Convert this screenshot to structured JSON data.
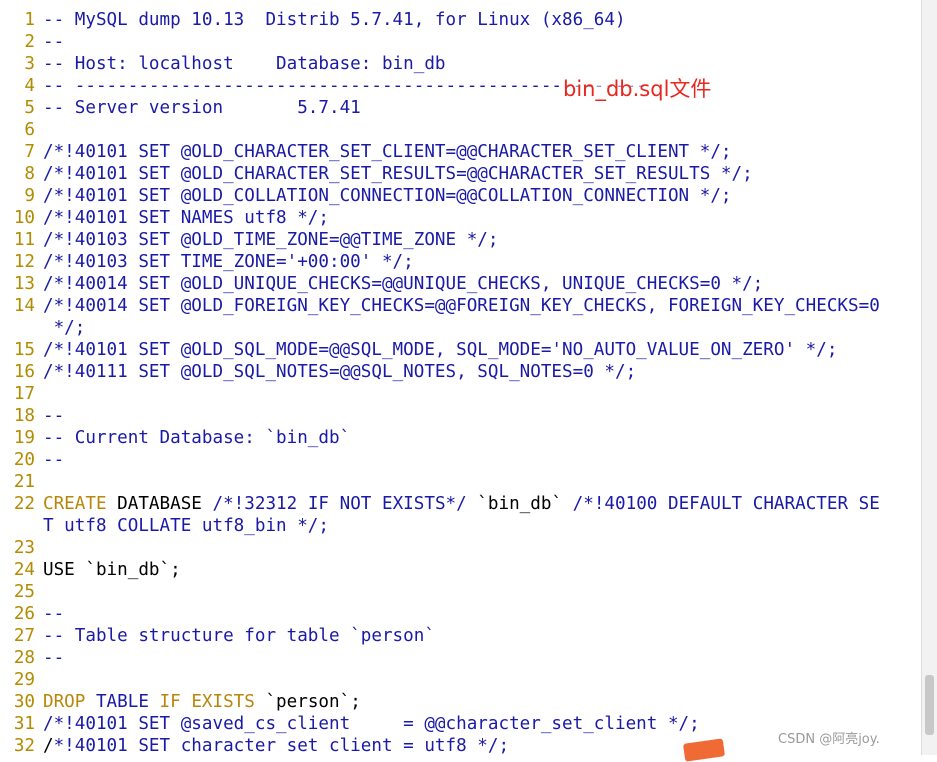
{
  "editor": {
    "lines": [
      {
        "n": "1",
        "segs": [
          {
            "t": "-- MySQL dump 10.13  Distrib 5.7.41, for Linux (x86_64)",
            "c": "comment"
          }
        ]
      },
      {
        "n": "2",
        "segs": [
          {
            "t": "--",
            "c": "comment"
          }
        ]
      },
      {
        "n": "3",
        "segs": [
          {
            "t": "-- Host: localhost    Database: bin_db",
            "c": "comment"
          }
        ]
      },
      {
        "n": "4",
        "segs": [
          {
            "t": "-- ------------------------------------------------------",
            "c": "comment"
          }
        ]
      },
      {
        "n": "5",
        "segs": [
          {
            "t": "-- Server version       5.7.41",
            "c": "comment"
          }
        ]
      },
      {
        "n": "6",
        "segs": []
      },
      {
        "n": "7",
        "segs": [
          {
            "t": "/*!40101 SET @OLD_CHARACTER_SET_CLIENT=@@CHARACTER_SET_CLIENT */;",
            "c": "comment"
          }
        ]
      },
      {
        "n": "8",
        "segs": [
          {
            "t": "/*!40101 SET @OLD_CHARACTER_SET_RESULTS=@@CHARACTER_SET_RESULTS */;",
            "c": "comment"
          }
        ]
      },
      {
        "n": "9",
        "segs": [
          {
            "t": "/*!40101 SET @OLD_COLLATION_CONNECTION=@@COLLATION_CONNECTION */;",
            "c": "comment"
          }
        ]
      },
      {
        "n": "10",
        "segs": [
          {
            "t": "/*!40101 SET NAMES utf8 */;",
            "c": "comment"
          }
        ]
      },
      {
        "n": "11",
        "segs": [
          {
            "t": "/*!40103 SET @OLD_TIME_ZONE=@@TIME_ZONE */;",
            "c": "comment"
          }
        ]
      },
      {
        "n": "12",
        "segs": [
          {
            "t": "/*!40103 SET TIME_ZONE='+00:00' */;",
            "c": "comment"
          }
        ]
      },
      {
        "n": "13",
        "segs": [
          {
            "t": "/*!40014 SET @OLD_UNIQUE_CHECKS=@@UNIQUE_CHECKS, UNIQUE_CHECKS=0 */;",
            "c": "comment"
          }
        ]
      },
      {
        "n": "14",
        "segs": [
          {
            "t": "/*!40014 SET @OLD_FOREIGN_KEY_CHECKS=@@FOREIGN_KEY_CHECKS, FOREIGN_KEY_CHECKS=0",
            "c": "comment"
          }
        ]
      },
      {
        "n": "",
        "segs": [
          {
            "t": " */;",
            "c": "comment"
          }
        ]
      },
      {
        "n": "15",
        "segs": [
          {
            "t": "/*!40101 SET @OLD_SQL_MODE=@@SQL_MODE, SQL_MODE='NO_AUTO_VALUE_ON_ZERO' */;",
            "c": "comment"
          }
        ]
      },
      {
        "n": "16",
        "segs": [
          {
            "t": "/*!40111 SET @OLD_SQL_NOTES=@@SQL_NOTES, SQL_NOTES=0 */;",
            "c": "comment"
          }
        ]
      },
      {
        "n": "17",
        "segs": []
      },
      {
        "n": "18",
        "segs": [
          {
            "t": "--",
            "c": "comment"
          }
        ]
      },
      {
        "n": "19",
        "segs": [
          {
            "t": "-- Current Database: `bin_db`",
            "c": "comment"
          }
        ]
      },
      {
        "n": "20",
        "segs": [
          {
            "t": "--",
            "c": "comment"
          }
        ]
      },
      {
        "n": "21",
        "segs": []
      },
      {
        "n": "22",
        "segs": [
          {
            "t": "CREATE",
            "c": "kw"
          },
          {
            "t": " DATABASE ",
            "c": "plain"
          },
          {
            "t": "/*!32312 IF NOT EXISTS*/",
            "c": "comment"
          },
          {
            "t": " `bin_db` ",
            "c": "plain"
          },
          {
            "t": "/*!40100 DEFAULT CHARACTER SE",
            "c": "comment"
          }
        ]
      },
      {
        "n": "",
        "segs": [
          {
            "t": "T utf8 COLLATE utf8_bin */;",
            "c": "comment"
          }
        ]
      },
      {
        "n": "23",
        "segs": []
      },
      {
        "n": "24",
        "segs": [
          {
            "t": "USE `bin_db`;",
            "c": "plain"
          }
        ]
      },
      {
        "n": "25",
        "segs": []
      },
      {
        "n": "26",
        "segs": [
          {
            "t": "--",
            "c": "comment"
          }
        ]
      },
      {
        "n": "27",
        "segs": [
          {
            "t": "-- Table structure for table `person`",
            "c": "comment"
          }
        ]
      },
      {
        "n": "28",
        "segs": [
          {
            "t": "--",
            "c": "comment"
          }
        ]
      },
      {
        "n": "29",
        "segs": []
      },
      {
        "n": "30",
        "segs": [
          {
            "t": "DROP",
            "c": "kw"
          },
          {
            "t": " ",
            "c": "plain"
          },
          {
            "t": "TABLE",
            "c": "kw2"
          },
          {
            "t": " ",
            "c": "plain"
          },
          {
            "t": "IF",
            "c": "kw"
          },
          {
            "t": " ",
            "c": "plain"
          },
          {
            "t": "EXISTS",
            "c": "kw"
          },
          {
            "t": " `person`;",
            "c": "plain"
          }
        ]
      },
      {
        "n": "31",
        "segs": [
          {
            "t": "/*!40101 SET @saved_cs_client     = @@character_set_client */;",
            "c": "comment"
          }
        ]
      },
      {
        "n": "32",
        "segs": [
          {
            "t": "/",
            "c": "cursor"
          },
          {
            "t": "*!40101 SET character set client = utf8 */;",
            "c": "comment"
          }
        ]
      }
    ]
  },
  "annotation": {
    "text": "bin_db.sql文件",
    "color": "#e8271f"
  },
  "watermark": {
    "text": "CSDN @阿亮joy."
  }
}
